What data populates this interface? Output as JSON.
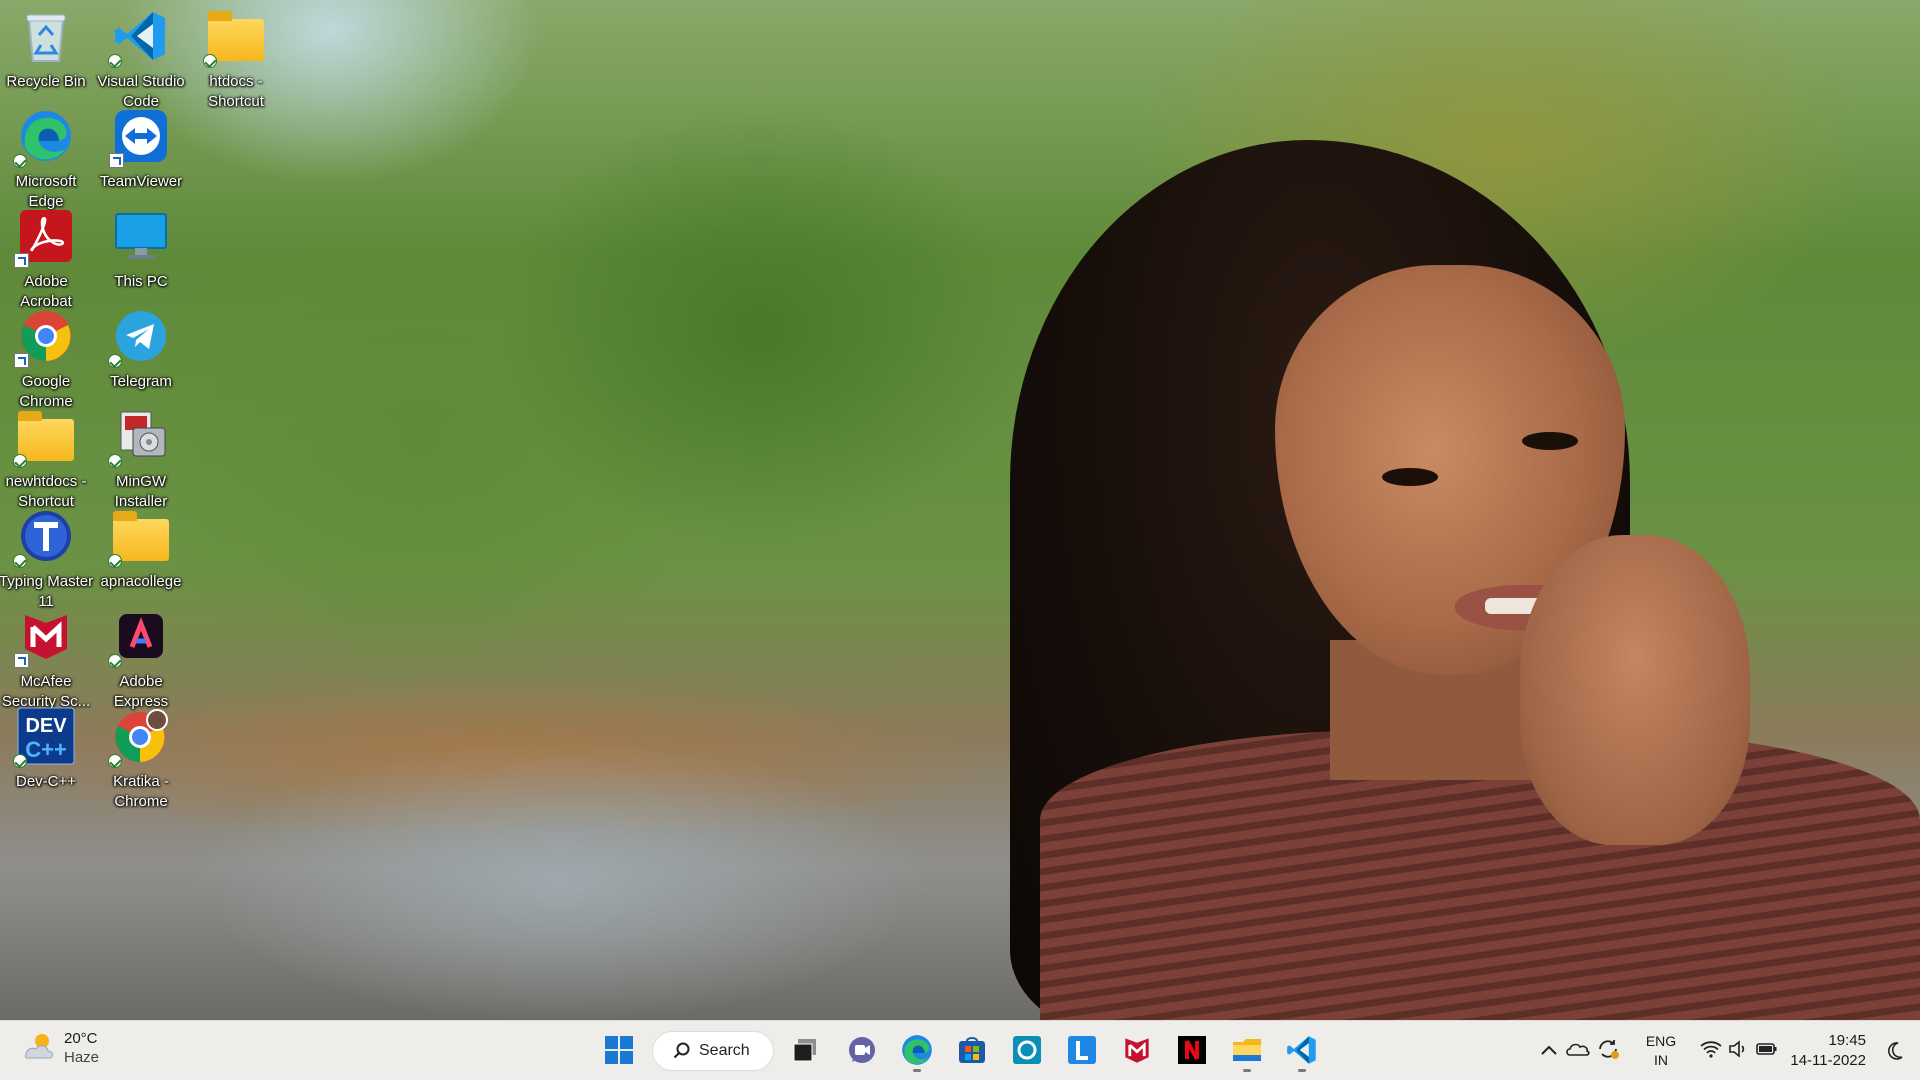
{
  "desktop_icons": [
    {
      "name": "recycle-bin",
      "label": "Recycle Bin",
      "icon": "recycle-bin-icon",
      "badge": "none"
    },
    {
      "name": "visual-studio-code",
      "label": "Visual Studio Code",
      "icon": "vscode-icon",
      "badge": "check"
    },
    {
      "name": "htdocs-shortcut",
      "label": "htdocs - Shortcut",
      "icon": "folder-icon",
      "badge": "check"
    },
    {
      "name": "microsoft-edge",
      "label": "Microsoft Edge",
      "icon": "edge-icon",
      "badge": "check"
    },
    {
      "name": "teamviewer",
      "label": "TeamViewer",
      "icon": "teamviewer-icon",
      "badge": "arrow"
    },
    {
      "name": "adobe-acrobat",
      "label": "Adobe Acrobat",
      "icon": "acrobat-icon",
      "badge": "arrow"
    },
    {
      "name": "this-pc",
      "label": "This PC",
      "icon": "monitor-icon",
      "badge": "none"
    },
    {
      "name": "google-chrome",
      "label": "Google Chrome",
      "icon": "chrome-icon",
      "badge": "arrow"
    },
    {
      "name": "telegram",
      "label": "Telegram",
      "icon": "telegram-icon",
      "badge": "check"
    },
    {
      "name": "newhtdocs-shortcut",
      "label": "newhtdocs - Shortcut",
      "icon": "folder-icon",
      "badge": "check"
    },
    {
      "name": "mingw-installer",
      "label": "MinGW Installer",
      "icon": "installer-icon",
      "badge": "check"
    },
    {
      "name": "typing-master",
      "label": "Typing Master 11",
      "icon": "typingmaster-icon",
      "badge": "check"
    },
    {
      "name": "apnacollege",
      "label": "apnacollege",
      "icon": "folder-icon",
      "badge": "check"
    },
    {
      "name": "mcafee",
      "label": "McAfee Security Sc...",
      "icon": "mcafee-icon",
      "badge": "arrow"
    },
    {
      "name": "adobe-express",
      "label": "Adobe Express",
      "icon": "adobe-express-icon",
      "badge": "check"
    },
    {
      "name": "dev-cpp",
      "label": "Dev-C++",
      "icon": "devcpp-icon",
      "badge": "check"
    },
    {
      "name": "kratika-chrome",
      "label": "Kratika - Chrome",
      "icon": "chrome-profile-icon",
      "badge": "check"
    }
  ],
  "taskbar": {
    "weather": {
      "temp": "20°C",
      "condition": "Haze",
      "icon": "weather-haze-icon"
    },
    "search_label": "Search",
    "apps": [
      {
        "name": "start",
        "icon": "windows-start-icon",
        "running": false
      },
      {
        "name": "task-view",
        "icon": "task-view-icon",
        "running": false
      },
      {
        "name": "chat",
        "icon": "teams-chat-icon",
        "running": false
      },
      {
        "name": "edge",
        "icon": "edge-icon",
        "running": true
      },
      {
        "name": "store",
        "icon": "store-icon",
        "running": false
      },
      {
        "name": "cortana-app",
        "icon": "circle-app-icon",
        "running": false
      },
      {
        "name": "l-app",
        "icon": "l-app-icon",
        "running": false
      },
      {
        "name": "mcafee",
        "icon": "mcafee-icon",
        "running": false
      },
      {
        "name": "netflix",
        "icon": "netflix-icon",
        "running": false
      },
      {
        "name": "file-explorer",
        "icon": "folder-icon",
        "running": true
      },
      {
        "name": "vscode",
        "icon": "vscode-icon",
        "running": true
      }
    ],
    "language": {
      "line1": "ENG",
      "line2": "IN"
    },
    "clock": {
      "time": "19:45",
      "date": "14-11-2022"
    }
  },
  "colors": {
    "taskbar_bg": "#eeece8",
    "accent_blue": "#0078d4",
    "folder_yellow": "#f5b81c"
  }
}
